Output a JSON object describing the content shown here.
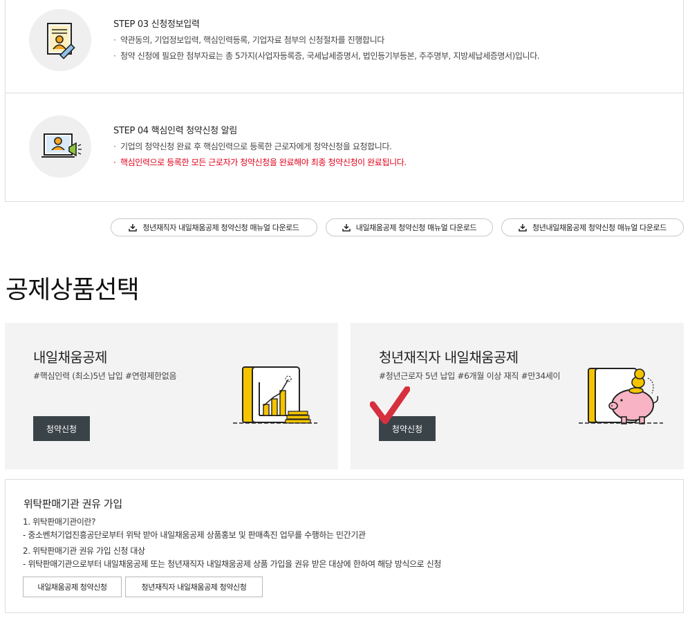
{
  "steps": [
    {
      "title": "STEP 03 신청정보입력",
      "icon": "document-user-pen-icon",
      "lines": [
        "약관동의, 기업정보입력, 핵심인력등록, 기업자료 첨부의 신청절차를 진행합니다",
        "청약 신청에 필요한 첨부자료는 총 5가지(사업자등록증, 국세납세증명서, 법인등기부등본, 주주명부, 지방세납세증명서)입니다."
      ]
    },
    {
      "title": "STEP 04 핵심인력 청약신청 알림",
      "icon": "monitor-megaphone-icon",
      "lines": [
        "기업의 청약신청 완료 후 핵심인력으로 등록한 근로자에게 청약신청을 요청합니다.",
        "핵심인력으로 등록한 모든 근로자가 청약신청을 완료해야 최종 청약신청이 완료됩니다."
      ],
      "highlight_color": "#e0001a"
    }
  ],
  "bullet": "·",
  "downloads": [
    "청년재직자 내일채움공제 청약신청 매뉴얼 다운로드",
    "내일채움공제 청약신청 매뉴얼 다운로드",
    "청년내일채움공제 청약신청 매뉴얼 다운로드"
  ],
  "section_title": "공제상품선택",
  "products": [
    {
      "title": "내일채움공제",
      "tags": "#핵심인력 (최소)5년 납입 #연령제한없음",
      "button": "청약신청",
      "illustration": "chart-growth-icon"
    },
    {
      "title": "청년재직자 내일채움공제",
      "tags": "#청년근로자 5년 납입 #6개월 이상 재직 #만34세이",
      "button": "청약신청",
      "illustration": "piggy-bank-icon"
    }
  ],
  "agency": {
    "title": "위탁판매기관 권유 가입",
    "lines": [
      "1. 위탁판매기관이란?",
      "- 중소벤처기업진흥공단로부터 위탁 받아 내일채움공제 상품홍보 및 판매촉진 업무를 수행하는 민간기관",
      "2. 위탁판매기관 권유 가입 신청 대상",
      "- 위탁판매기관으로부터 내일채움공제 또는 청년재직자 내일채움공제 상품 가입을 권유 받은 대상에 한하여 해당 방식으로 신청"
    ],
    "buttons": [
      "내일채움공제 청약신청",
      "청년재직자 내일채움공제 청약신청"
    ]
  },
  "colors": {
    "accent_yellow": "#f5c400",
    "button_dark": "#3a4448",
    "checkmark_red": "#d6303f",
    "highlight_red": "#e0001a"
  }
}
